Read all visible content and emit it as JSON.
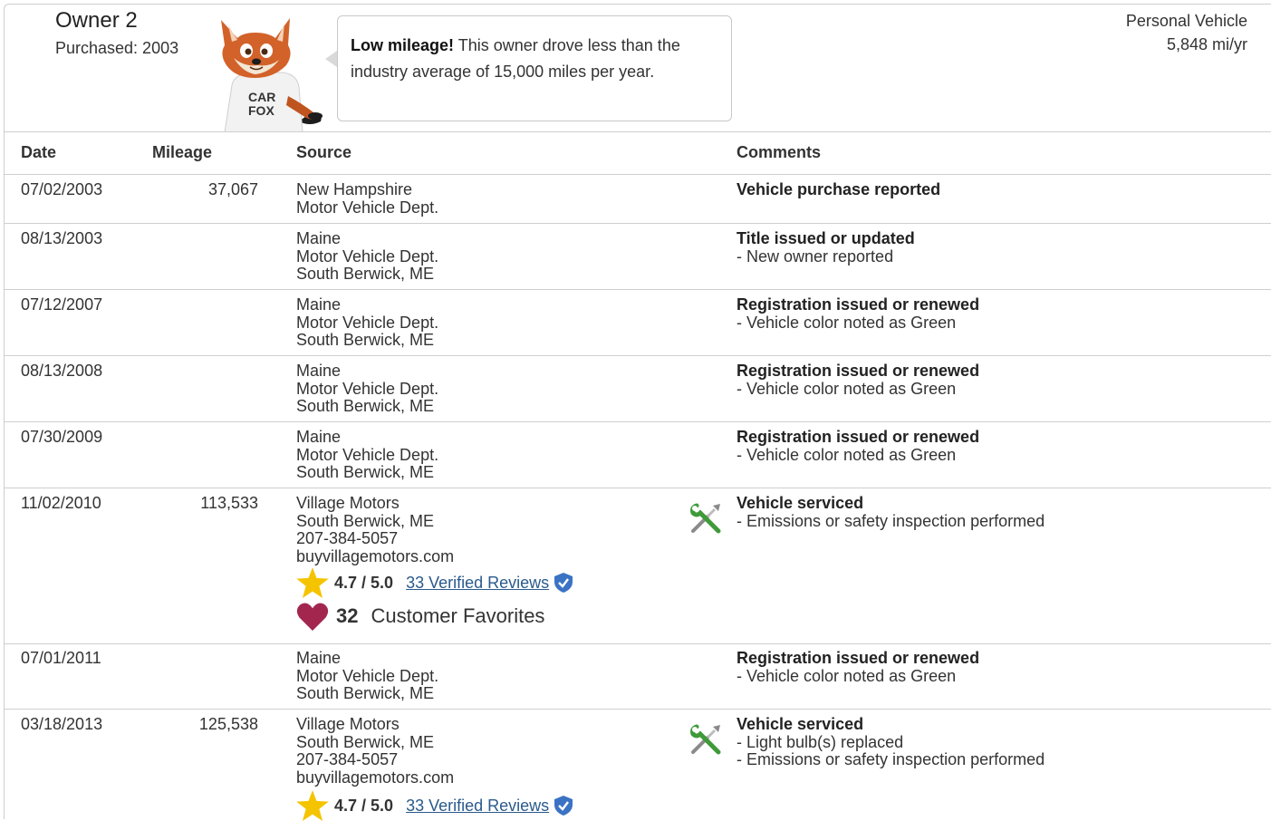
{
  "owner": {
    "title": "Owner 2",
    "purchased": "Purchased: 2003",
    "tip_bold": "Low mileage!",
    "tip_text": " This owner drove less than the industry average of 15,000 miles per year.",
    "fox_shirt_line1": "CAR",
    "fox_shirt_line2": "FOX",
    "vehicle_type": "Personal Vehicle",
    "mileage_rate": "5,848 mi/yr"
  },
  "columns": [
    "Date",
    "Mileage",
    "Source",
    "Comments"
  ],
  "records": [
    {
      "date": "07/02/2003",
      "mileage": "37,067",
      "source": [
        "New Hampshire",
        "Motor Vehicle Dept."
      ],
      "comment_head": "Vehicle purchase reported",
      "comment_lines": []
    },
    {
      "date": "08/13/2003",
      "mileage": "",
      "source": [
        "Maine",
        "Motor Vehicle Dept.",
        "South Berwick, ME"
      ],
      "comment_head": "Title issued or updated",
      "comment_lines": [
        "- New owner reported"
      ]
    },
    {
      "date": "07/12/2007",
      "mileage": "",
      "source": [
        "Maine",
        "Motor Vehicle Dept.",
        "South Berwick, ME"
      ],
      "comment_head": "Registration issued or renewed",
      "comment_lines": [
        "- Vehicle color noted as Green"
      ]
    },
    {
      "date": "08/13/2008",
      "mileage": "",
      "source": [
        "Maine",
        "Motor Vehicle Dept.",
        "South Berwick, ME"
      ],
      "comment_head": "Registration issued or renewed",
      "comment_lines": [
        "- Vehicle color noted as Green"
      ]
    },
    {
      "date": "07/30/2009",
      "mileage": "",
      "source": [
        "Maine",
        "Motor Vehicle Dept.",
        "South Berwick, ME"
      ],
      "comment_head": "Registration issued or renewed",
      "comment_lines": [
        "- Vehicle color noted as Green"
      ]
    },
    {
      "date": "11/02/2010",
      "mileage": "113,533",
      "source": [
        "Village Motors",
        "South Berwick, ME",
        "207-384-5057",
        "buyvillagemotors.com"
      ],
      "comment_head": "Vehicle serviced",
      "comment_lines": [
        "- Emissions or safety inspection performed"
      ],
      "service_icon": "wrench-screwdriver-icon",
      "rating": "4.7 / 5.0",
      "reviews": "33 Verified Reviews",
      "favorites_count": "32",
      "favorites_label": "Customer Favorites"
    },
    {
      "date": "07/01/2011",
      "mileage": "",
      "source": [
        "Maine",
        "Motor Vehicle Dept.",
        "South Berwick, ME"
      ],
      "comment_head": "Registration issued or renewed",
      "comment_lines": [
        "- Vehicle color noted as Green"
      ]
    },
    {
      "date": "03/18/2013",
      "mileage": "125,538",
      "source": [
        "Village Motors",
        "South Berwick, ME",
        "207-384-5057",
        "buyvillagemotors.com"
      ],
      "comment_head": "Vehicle serviced",
      "comment_lines": [
        "- Light bulb(s) replaced",
        "- Emissions or safety inspection performed"
      ],
      "service_icon": "wrench-screwdriver-icon",
      "rating": "4.7 / 5.0",
      "reviews": "33 Verified Reviews"
    }
  ],
  "colors": {
    "star": "#f5c400",
    "heart": "#a3264f",
    "verified": "#3b73c4",
    "link": "#2a5a8c",
    "wrench": "#3f9a3a",
    "border": "#cfcfcf"
  }
}
